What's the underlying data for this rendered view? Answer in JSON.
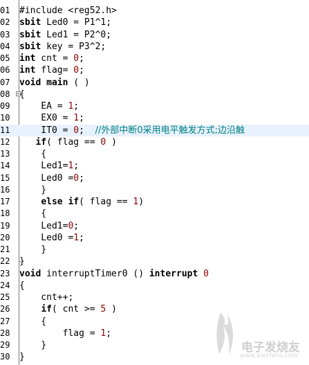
{
  "editor": {
    "lines": [
      {
        "num": "01",
        "parts": [
          {
            "t": "#include <reg52.h>",
            "c": ""
          }
        ]
      },
      {
        "num": "02",
        "parts": [
          {
            "t": "sbit",
            "c": "kw"
          },
          {
            "t": " Led0 = P1^1;",
            "c": ""
          }
        ]
      },
      {
        "num": "03",
        "parts": [
          {
            "t": "sbit",
            "c": "kw"
          },
          {
            "t": " Led1 = P2^0;",
            "c": ""
          }
        ]
      },
      {
        "num": "04",
        "parts": [
          {
            "t": "sbit",
            "c": "kw"
          },
          {
            "t": " key = P3^2;",
            "c": ""
          }
        ]
      },
      {
        "num": "05",
        "parts": [
          {
            "t": "int",
            "c": "kw"
          },
          {
            "t": " cnt = ",
            "c": ""
          },
          {
            "t": "0",
            "c": "num"
          },
          {
            "t": ";",
            "c": ""
          }
        ]
      },
      {
        "num": "06",
        "parts": [
          {
            "t": "int",
            "c": "kw"
          },
          {
            "t": " flag= ",
            "c": ""
          },
          {
            "t": "0",
            "c": "num"
          },
          {
            "t": ";",
            "c": ""
          }
        ]
      },
      {
        "num": "07",
        "parts": [
          {
            "t": "void",
            "c": "kw"
          },
          {
            "t": " ",
            "c": ""
          },
          {
            "t": "main",
            "c": "kw"
          },
          {
            "t": " ( )",
            "c": ""
          }
        ]
      },
      {
        "num": "08",
        "fold": "open",
        "parts": [
          {
            "t": "{",
            "c": ""
          }
        ]
      },
      {
        "num": "09",
        "parts": [
          {
            "t": "    EA = ",
            "c": ""
          },
          {
            "t": "1",
            "c": "num"
          },
          {
            "t": ";",
            "c": ""
          }
        ]
      },
      {
        "num": "10",
        "parts": [
          {
            "t": "    EX0 = ",
            "c": ""
          },
          {
            "t": "1",
            "c": "num"
          },
          {
            "t": ";",
            "c": ""
          }
        ]
      },
      {
        "num": "11",
        "current": true,
        "parts": [
          {
            "t": "    IT0 = ",
            "c": ""
          },
          {
            "t": "0",
            "c": "num"
          },
          {
            "t": ";  ",
            "c": ""
          },
          {
            "t": "//外部中断0采用电平触发方式;边沿触",
            "c": "cmt"
          }
        ]
      },
      {
        "num": "12",
        "parts": [
          {
            "t": "   ",
            "c": ""
          },
          {
            "t": "if",
            "c": "kw"
          },
          {
            "t": "( flag == ",
            "c": ""
          },
          {
            "t": "0",
            "c": "num"
          },
          {
            "t": " )",
            "c": ""
          }
        ]
      },
      {
        "num": "13",
        "parts": [
          {
            "t": "    {",
            "c": ""
          }
        ]
      },
      {
        "num": "14",
        "parts": [
          {
            "t": "    Led1=",
            "c": ""
          },
          {
            "t": "1",
            "c": "num"
          },
          {
            "t": ";",
            "c": ""
          }
        ]
      },
      {
        "num": "15",
        "parts": [
          {
            "t": "    Led0 =",
            "c": ""
          },
          {
            "t": "0",
            "c": "num"
          },
          {
            "t": ";",
            "c": ""
          }
        ]
      },
      {
        "num": "16",
        "parts": [
          {
            "t": "    }",
            "c": ""
          }
        ]
      },
      {
        "num": "17",
        "parts": [
          {
            "t": "    ",
            "c": ""
          },
          {
            "t": "else",
            "c": "kw"
          },
          {
            "t": " ",
            "c": ""
          },
          {
            "t": "if",
            "c": "kw"
          },
          {
            "t": "( flag == ",
            "c": ""
          },
          {
            "t": "1",
            "c": "num"
          },
          {
            "t": ")",
            "c": ""
          }
        ]
      },
      {
        "num": "18",
        "parts": [
          {
            "t": "    {",
            "c": ""
          }
        ]
      },
      {
        "num": "19",
        "parts": [
          {
            "t": "    Led1=",
            "c": ""
          },
          {
            "t": "0",
            "c": "num"
          },
          {
            "t": ";",
            "c": ""
          }
        ]
      },
      {
        "num": "20",
        "parts": [
          {
            "t": "    Led0 =",
            "c": ""
          },
          {
            "t": "1",
            "c": "num"
          },
          {
            "t": ";",
            "c": ""
          }
        ]
      },
      {
        "num": "21",
        "parts": [
          {
            "t": "    }",
            "c": ""
          }
        ]
      },
      {
        "num": "22",
        "fold": "end",
        "parts": [
          {
            "t": "}",
            "c": ""
          }
        ]
      },
      {
        "num": "23",
        "parts": [
          {
            "t": "void",
            "c": "kw"
          },
          {
            "t": " interruptTimer0 () ",
            "c": ""
          },
          {
            "t": "interrupt",
            "c": "kw"
          },
          {
            "t": " ",
            "c": ""
          },
          {
            "t": "0",
            "c": "num"
          }
        ]
      },
      {
        "num": "24",
        "parts": [
          {
            "t": "{",
            "c": ""
          }
        ]
      },
      {
        "num": "25",
        "parts": [
          {
            "t": "    cnt++;",
            "c": ""
          }
        ]
      },
      {
        "num": "26",
        "parts": [
          {
            "t": "    ",
            "c": ""
          },
          {
            "t": "if",
            "c": "kw"
          },
          {
            "t": "( cnt >= ",
            "c": ""
          },
          {
            "t": "5",
            "c": "num"
          },
          {
            "t": " )",
            "c": ""
          }
        ]
      },
      {
        "num": "27",
        "parts": [
          {
            "t": "    {",
            "c": ""
          }
        ]
      },
      {
        "num": "28",
        "parts": [
          {
            "t": "        flag = ",
            "c": ""
          },
          {
            "t": "1",
            "c": "num"
          },
          {
            "t": ";",
            "c": ""
          }
        ]
      },
      {
        "num": "29",
        "parts": [
          {
            "t": "    }",
            "c": ""
          }
        ]
      },
      {
        "num": "30",
        "parts": [
          {
            "t": "}",
            "c": ""
          }
        ]
      }
    ]
  },
  "watermark": {
    "text": "电子发烧友",
    "url": "www.elecfans.com"
  },
  "colors": {
    "keyword": "#000000",
    "number": "#8b0000",
    "comment": "#008080",
    "current_line": "#e8f2fe"
  }
}
